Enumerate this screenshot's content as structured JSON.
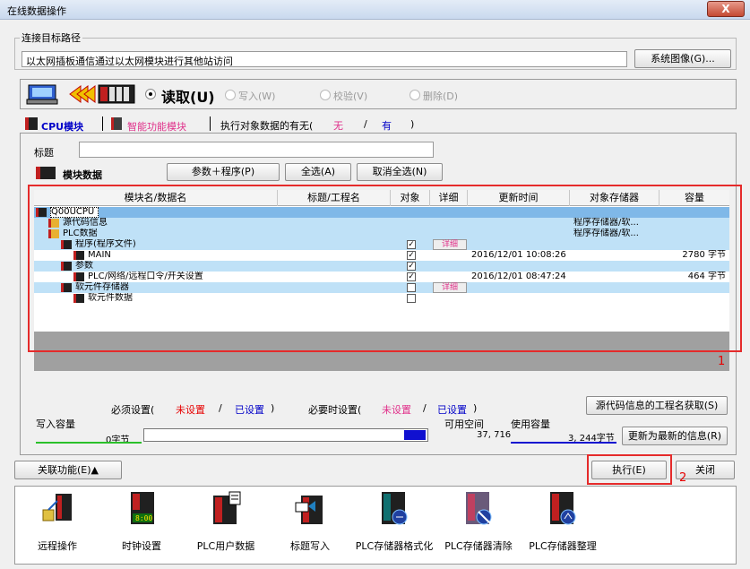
{
  "window": {
    "title": "在线数据操作",
    "close_glyph": "X"
  },
  "connection": {
    "group_label": "连接目标路径",
    "path": "以太网插板通信通过以太网模块进行其他站访问",
    "system_image_button": "系统图像(G)..."
  },
  "modes": {
    "read": "读取(U)",
    "write": "写入(W)",
    "verify": "校验(V)",
    "delete": "删除(D)"
  },
  "tabs": {
    "cpu": "CPU模块",
    "intelligent": "智能功能模块",
    "presence_label": "执行对象数据的有无(",
    "none": "无",
    "slash": "/",
    "exists": "有",
    "close_paren": ")"
  },
  "title_field": {
    "label": "标题",
    "value": ""
  },
  "module_data": {
    "label": "模块数据",
    "param_prog_button": "参数＋程序(P)",
    "select_all_button": "全选(A)",
    "deselect_all_button": "取消全选(N)"
  },
  "table": {
    "columns": [
      "模块名/数据名",
      "标题/工程名",
      "对象",
      "详细",
      "更新时间",
      "对象存储器",
      "容量"
    ],
    "rows": [
      {
        "name": "Q00UCPU",
        "checked": null,
        "detail": "",
        "time": "",
        "memory": "",
        "size": "",
        "style": "sel"
      },
      {
        "name": "源代码信息",
        "checked": null,
        "detail": "",
        "time": "",
        "memory": "程序存储器/软...",
        "size": "",
        "style": "blue-bg"
      },
      {
        "name": "PLC数据",
        "checked": null,
        "detail": "",
        "time": "",
        "memory": "程序存储器/软...",
        "size": "",
        "style": "blue-bg"
      },
      {
        "name": "程序(程序文件)",
        "checked": true,
        "detail": "详细",
        "time": "",
        "memory": "",
        "size": "",
        "style": "blue-bg"
      },
      {
        "name": "MAIN",
        "checked": true,
        "detail": "",
        "time": "2016/12/01 10:08:26",
        "memory": "",
        "size": "2780 字节",
        "style": "plain"
      },
      {
        "name": "参数",
        "checked": true,
        "detail": "",
        "time": "",
        "memory": "",
        "size": "",
        "style": "blue-bg"
      },
      {
        "name": "PLC/网络/远程口令/开关设置",
        "checked": true,
        "detail": "",
        "time": "2016/12/01 08:47:24",
        "memory": "",
        "size": "464 字节",
        "style": "plain"
      },
      {
        "name": "软元件存储器",
        "checked": false,
        "detail": "详细",
        "time": "",
        "memory": "",
        "size": "",
        "style": "blue-bg"
      },
      {
        "name": "软元件数据",
        "checked": false,
        "detail": "",
        "time": "",
        "memory": "",
        "size": "",
        "style": "plain"
      }
    ],
    "check_glyph": "✓"
  },
  "annotation_1": "1",
  "annotation_2": "2",
  "settings_legend": {
    "required": "必须设置(",
    "not_set": "未设置",
    "slash": "/",
    "set": "已设置",
    "close_paren": ")",
    "when_needed": "必要时设置(",
    "not_set2": "未设置",
    "set2": "已设置",
    "close_paren2": ")"
  },
  "source_name_button": "源代码信息的工程名获取(S)",
  "capacity": {
    "write_label": "写入容量",
    "write_value": "0字节",
    "free_label": "可用空间",
    "free_value": "37, 716",
    "used_label": "使用容量",
    "used_value": "3, 244字节",
    "refresh_button": "更新为最新的信息(R)"
  },
  "related_button": "关联功能(E)▲",
  "execute_button": "执行(E)",
  "close_button": "关闭",
  "tools": [
    "远程操作",
    "时钟设置",
    "PLC用户数据",
    "标题写入",
    "PLC存储器格式化",
    "PLC存储器清除",
    "PLC存储器整理"
  ],
  "clock_text": "8:00",
  "colors": {
    "red_box": "#e52b2b",
    "selected_row": "#7fb8e8",
    "light_row": "#bfe1f7",
    "pink": "#e0308a",
    "blue": "#0000c8"
  }
}
